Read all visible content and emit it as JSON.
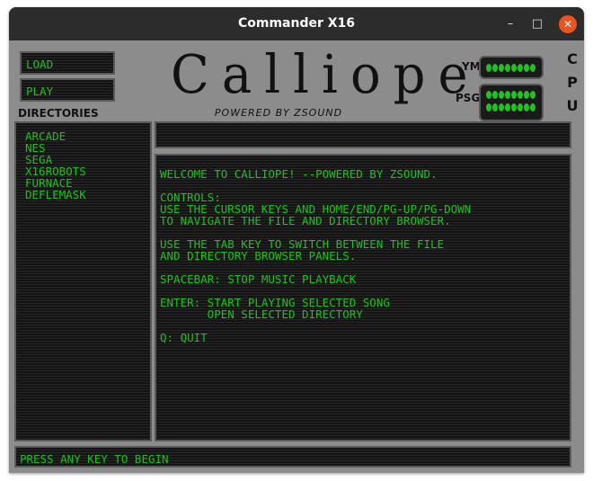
{
  "window": {
    "title": "Commander X16",
    "controls": {
      "minimize": "–",
      "maximize": "□",
      "close": "✕"
    }
  },
  "buttons": {
    "load": "LOAD",
    "play": "PLAY"
  },
  "logo": {
    "title": "Calliope",
    "subtitle": "POWERED BY ZSOUND"
  },
  "meters": {
    "ym_label": "YM",
    "psg_label": "PSG",
    "cpu_label": [
      "C",
      "P",
      "U"
    ]
  },
  "directories": {
    "label": "DIRECTORIES",
    "items": [
      "ARCADE",
      "NES",
      "SEGA",
      "X16ROBOTS",
      "FURNACE",
      "DEFLEMASK"
    ]
  },
  "content": {
    "lines": [
      "WELCOME TO CALLIOPE! --POWERED BY ZSOUND.",
      "",
      "CONTROLS:",
      "USE THE CURSOR KEYS AND HOME/END/PG-UP/PG-DOWN",
      "TO NAVIGATE THE FILE AND DIRECTORY BROWSER.",
      "",
      "USE THE TAB KEY TO SWITCH BETWEEN THE FILE",
      "AND DIRECTORY BROWSER PANELS.",
      "",
      "SPACEBAR: STOP MUSIC PLAYBACK",
      "",
      "ENTER: START PLAYING SELECTED SONG",
      "       OPEN SELECTED DIRECTORY",
      "",
      "Q: QUIT"
    ]
  },
  "status": {
    "text": "PRESS ANY KEY TO BEGIN"
  },
  "colors": {
    "text_green": "#1fc11f",
    "panel_bg": "#8c8c8c",
    "close_button": "#e95420"
  }
}
